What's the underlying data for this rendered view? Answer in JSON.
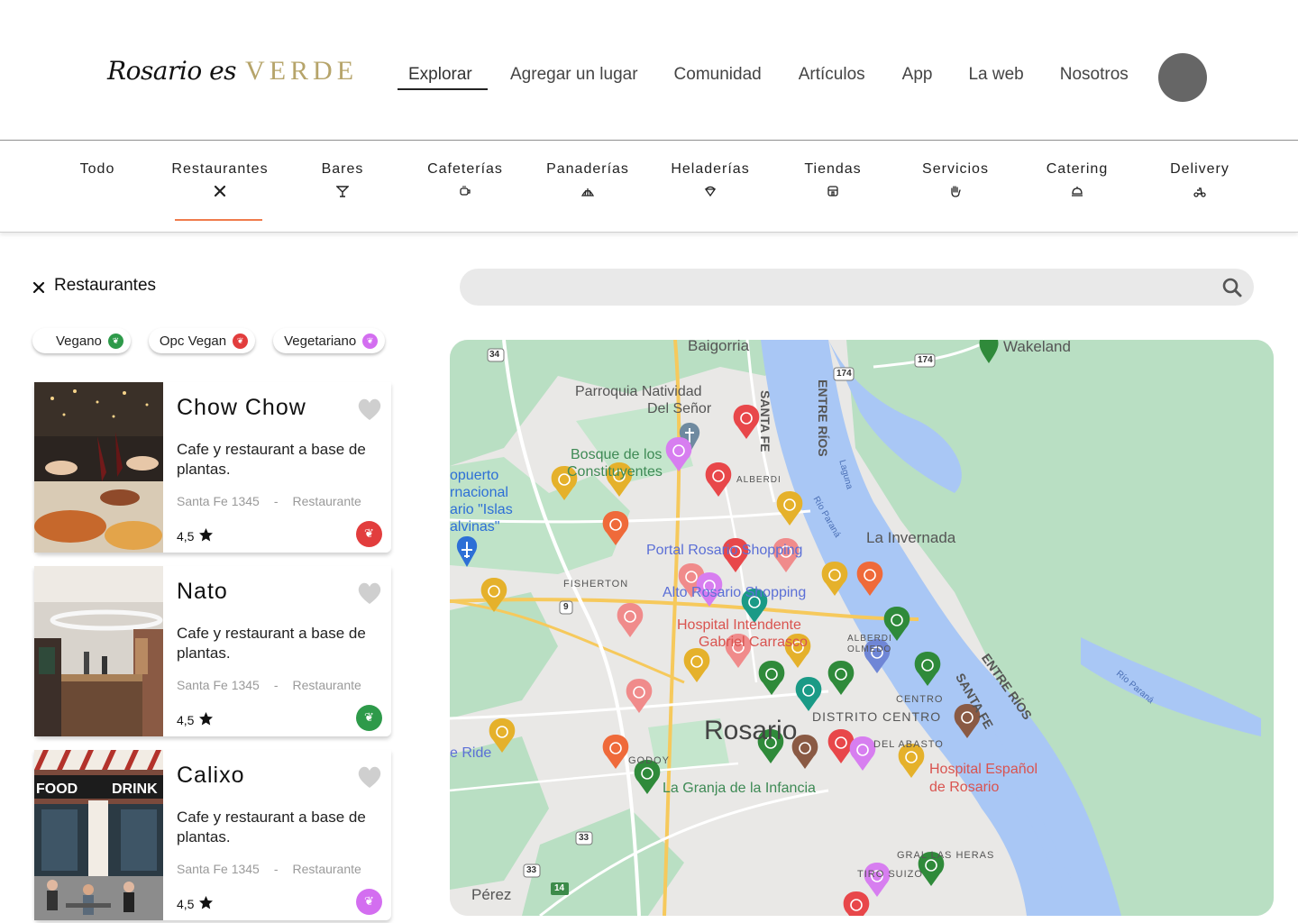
{
  "brand": {
    "script": "Rosario es",
    "verde": "VERDE"
  },
  "nav": {
    "items": [
      "Explorar",
      "Agregar un lugar",
      "Comunidad",
      "Artículos",
      "App",
      "La web",
      "Nosotros"
    ],
    "active": "Explorar"
  },
  "categories": {
    "items": [
      {
        "label": "Todo",
        "icon": "none"
      },
      {
        "label": "Restaurantes",
        "icon": "fork-knife-icon"
      },
      {
        "label": "Bares",
        "icon": "cocktail-icon"
      },
      {
        "label": "Cafeterías",
        "icon": "coffee-cup-icon"
      },
      {
        "label": "Panaderías",
        "icon": "croissant-icon"
      },
      {
        "label": "Heladerías",
        "icon": "ice-cream-icon"
      },
      {
        "label": "Tiendas",
        "icon": "store-icon"
      },
      {
        "label": "Servicios",
        "icon": "hand-icon"
      },
      {
        "label": "Catering",
        "icon": "cloche-icon"
      },
      {
        "label": "Delivery",
        "icon": "scooter-icon"
      }
    ],
    "active": "Restaurantes"
  },
  "list": {
    "title": "Restaurantes",
    "filters": [
      {
        "label": "Vegano",
        "color": "#2e9a4a"
      },
      {
        "label": "Opc Vegan",
        "color": "#e23d3d"
      },
      {
        "label": "Vegetariano",
        "color": "#d36ef0"
      }
    ],
    "cards": [
      {
        "name": "Chow Chow",
        "desc": "Cafe y restaurant a base de plantas.",
        "address": "Santa Fe 1345",
        "sep": "-",
        "type": "Restaurante",
        "rating": "4,5",
        "badge_color": "#e23d3d"
      },
      {
        "name": "Nato",
        "desc": "Cafe y restaurant a base de plantas.",
        "address": "Santa Fe 1345",
        "sep": "-",
        "type": "Restaurante",
        "rating": "4,5",
        "badge_color": "#2e9a4a"
      },
      {
        "name": "Calixo",
        "desc": "Cafe y restaurant a base de plantas.",
        "address": "Santa Fe 1345",
        "sep": "-",
        "type": "Restaurante",
        "rating": "4,5",
        "badge_color": "#d36ef0"
      }
    ],
    "photo_text": {
      "food": "FOOD",
      "drink": "DRINK"
    }
  },
  "search": {
    "placeholder": ""
  },
  "map": {
    "labels": {
      "baigorria": "Baigorria",
      "wakeland": "Wakeland",
      "parroquia": "Parroquia Natividad",
      "del_senor": "Del Señor",
      "bosque": "Bosque de los",
      "constituyentes": "Constituyentes",
      "aeropuerto1": "opuerto",
      "aeropuerto2": "rnacional",
      "aeropuerto3": "ario \"Islas",
      "aeropuerto4": "alvinas\"",
      "santa_fe_v": "SANTA FE",
      "entre_rios_v": "ENTRE RÍOS",
      "alberdi": "ALBERDI",
      "laguna": "Laguna",
      "rio_parana": "Río Paraná",
      "la_invernada": "La Invernada",
      "portal": "Portal Rosario Shopping",
      "fisherton": "FISHERTON",
      "alto": "Alto Rosario Shopping",
      "hospital1": "Hospital Intendente",
      "hospital2": "Gabriel Carrasco",
      "alberdi_olmedo1": "ALBERDI",
      "alberdi_olmedo2": "OLMEDO",
      "entre_rios_d": "ENTRE RÍOS",
      "santa_fe_d": "SANTA FE",
      "rio_parana_d": "Río Paraná",
      "centro": "CENTRO",
      "distrito": "DISTRITO CENTRO",
      "rosario": "Rosario",
      "del_abasto": "DEL ABASTO",
      "hospital_esp1": "Hospital Español",
      "hospital_esp2": "de Rosario",
      "ride": "e Ride",
      "godoy": "GODOY",
      "granja": "La Granja de la Infancia",
      "gral_las_heras": "GRAL LAS HERAS",
      "tiro_suizo": "TIRO SUIZO",
      "perez": "Pérez",
      "r34": "34",
      "r174a": "174",
      "r174b": "174",
      "r9": "9",
      "r33a": "33",
      "r33b": "33",
      "r14": "14"
    }
  },
  "colors": {
    "accent": "#f07b4c",
    "verde": "#b6a46a",
    "pin_red": "#e8474a",
    "pin_yellow": "#e5b12b",
    "pin_pink": "#f08b8b",
    "pin_green": "#2f8a3a",
    "pin_teal": "#1a9a86",
    "pin_purple": "#d77ef0",
    "pin_brown": "#8a5a44",
    "pin_orange": "#ef6a3a",
    "pin_blue": "#6f86d6",
    "water": "#a9c7f5",
    "park": "#b9dfc3"
  }
}
